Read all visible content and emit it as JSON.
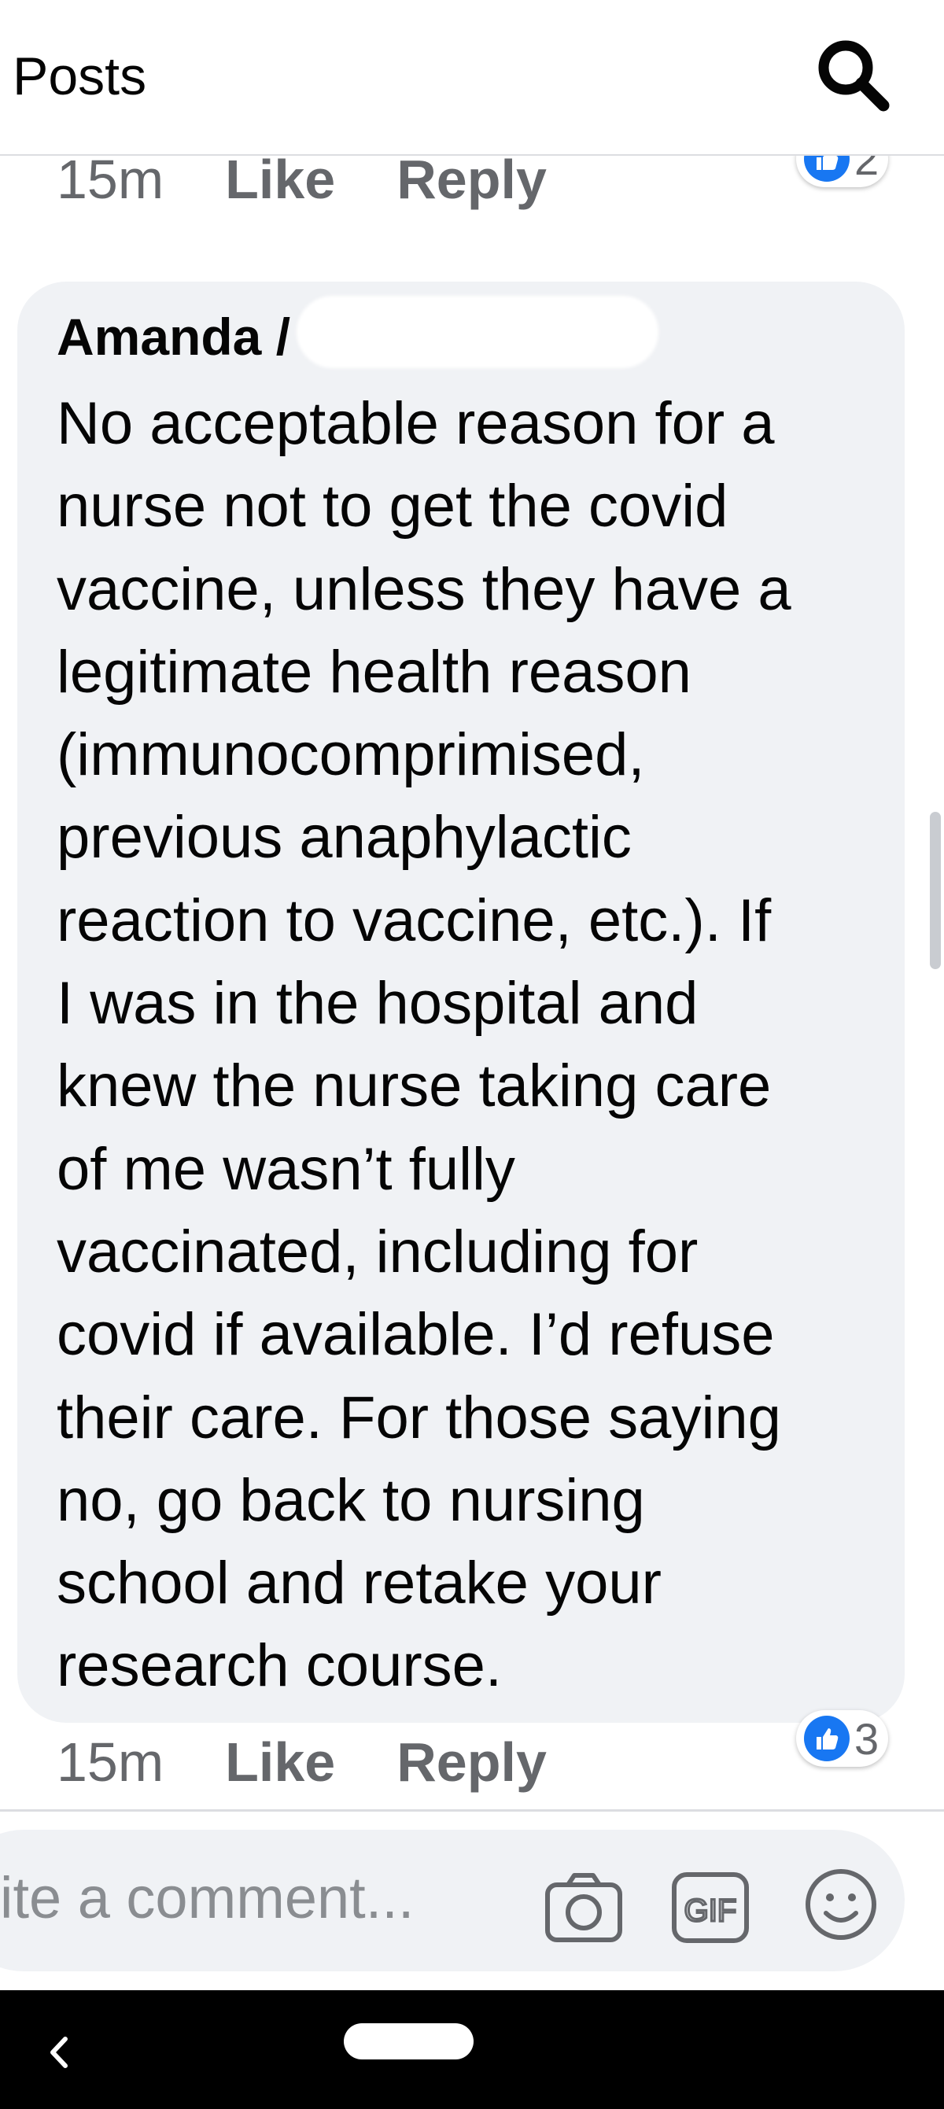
{
  "header": {
    "title": "Posts",
    "search_icon": "search-icon"
  },
  "previous_comment": {
    "time": "15m",
    "like_label": "Like",
    "reply_label": "Reply",
    "reaction_count": "2"
  },
  "comment": {
    "author": "Amanda /",
    "lines": [
      "No acceptable reason for a",
      "nurse not to get the covid",
      "vaccine, unless they have a",
      "legitimate health reason",
      "(immunocomprimised,",
      "previous anaphylactic",
      "reaction to vaccine, etc.). If",
      "I was in the hospital and",
      "knew the nurse taking care",
      "of me wasn’t fully",
      "vaccinated, including for",
      "covid if available. I’d refuse",
      "their care. For those saying",
      "no, go back to nursing",
      "school and retake your",
      "research course."
    ],
    "time": "15m",
    "like_label": "Like",
    "reply_label": "Reply",
    "reaction_count": "3"
  },
  "composer": {
    "placeholder": "ite a comment...",
    "icons": [
      "camera-icon",
      "gif-icon",
      "emoji-icon"
    ]
  },
  "colors": {
    "accent": "#1877f2",
    "bubble_bg": "#f0f2f5",
    "meta_text": "#65676b",
    "placeholder_text": "#8a8d91"
  }
}
